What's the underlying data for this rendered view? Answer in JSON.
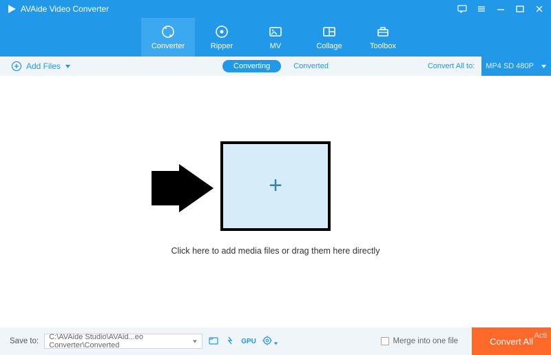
{
  "title": "AVAide Video Converter",
  "nav": {
    "items": [
      {
        "label": "Converter"
      },
      {
        "label": "Ripper"
      },
      {
        "label": "MV"
      },
      {
        "label": "Collage"
      },
      {
        "label": "Toolbox"
      }
    ]
  },
  "subbar": {
    "add_files": "Add Files",
    "converting": "Converting",
    "converted": "Converted",
    "convert_all_to": "Convert All to:",
    "format": "MP4 SD 480P"
  },
  "main": {
    "hint": "Click here to add media files or drag them here directly"
  },
  "footer": {
    "save_to_label": "Save to:",
    "path": "C:\\AVAide Studio\\AVAid...eo Converter\\Converted",
    "merge_label": "Merge into one file",
    "convert_all": "Convert All"
  },
  "watermark": "Acti"
}
